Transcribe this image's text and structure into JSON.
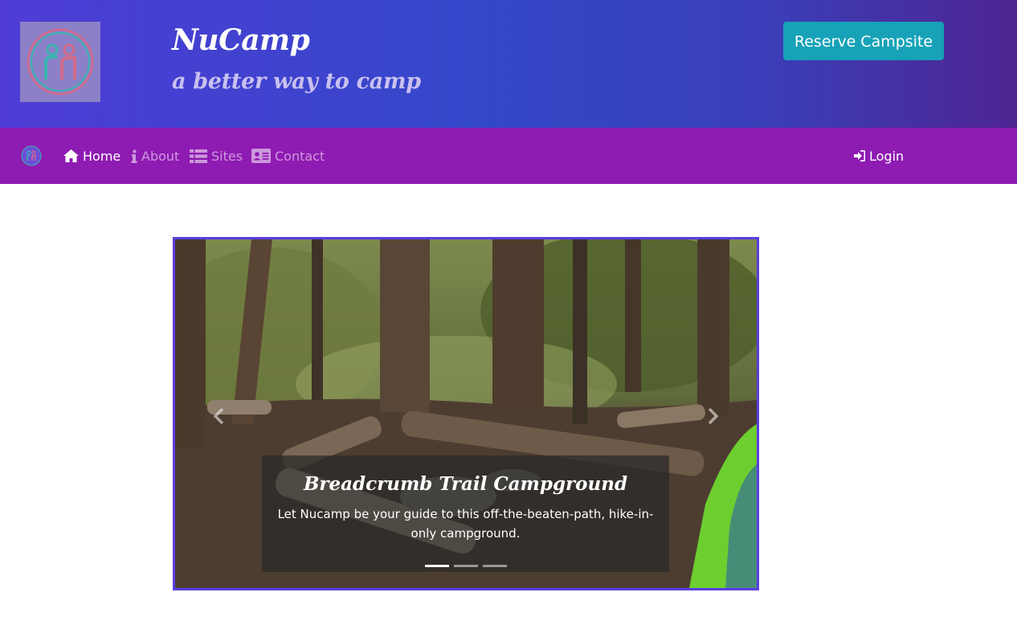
{
  "header": {
    "brand_title": "NuCamp",
    "brand_subtitle": "a better way to camp",
    "reserve_button": "Reserve Campsite",
    "logo_icon": "nucamp-logo-icon"
  },
  "navbar": {
    "items": [
      {
        "label": "Home",
        "icon": "home-icon",
        "active": true
      },
      {
        "label": "About",
        "icon": "info-icon",
        "active": false
      },
      {
        "label": "Sites",
        "icon": "list-icon",
        "active": false
      },
      {
        "label": "Contact",
        "icon": "address-card-icon",
        "active": false
      }
    ],
    "login": {
      "label": "Login",
      "icon": "sign-in-icon"
    }
  },
  "carousel": {
    "caption_title": "Breadcrumb Trail Campground",
    "caption_text": "Let Nucamp be your guide to this off-the-beaten-path, hike-in-only campground.",
    "active_slide": 1,
    "slide_count": 3
  },
  "colors": {
    "header_gradient_start": "#4f3cd6",
    "header_gradient_end": "#4e2592",
    "navbar": "#8e1bb2",
    "reserve_button": "#17a2b8",
    "carousel_border": "#5a3ee0"
  }
}
